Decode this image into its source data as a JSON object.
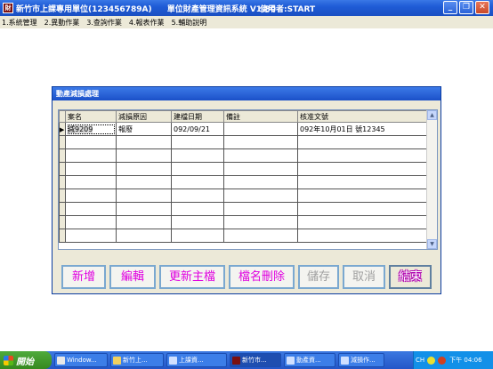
{
  "window": {
    "title_org": "新竹市上課專用單位(123456789A)",
    "title_system": "單位財產管理資訊系統  V1.80",
    "title_user": "使用者:START",
    "minimize": "_",
    "maximize": "❐",
    "close": "✕"
  },
  "menu": [
    "1.系統管理",
    "2.異動作業",
    "3.查詢作業",
    "4.報表作業",
    "5.輔助說明"
  ],
  "dialog": {
    "title": "動產減損處理",
    "columns": [
      "案名",
      "減損原因",
      "建檔日期",
      "備註",
      "核准文號"
    ],
    "rows": [
      [
        "減9209",
        "報廢",
        "092/09/21",
        "",
        "092年10月01日 號12345"
      ]
    ],
    "buttons": {
      "add": "新增",
      "edit": "編輯",
      "update_master": "更新主檔",
      "delete": "檔名刪除",
      "save": "儲存",
      "cancel": "取消",
      "exit": "結束"
    }
  },
  "taskbar": {
    "start": "開始",
    "tasks": [
      "Window...",
      "新竹上...",
      "上課資...",
      "新竹市...",
      "動產資...",
      "減損作..."
    ],
    "tray_lang": "CH",
    "clock": "下午 04:06"
  }
}
